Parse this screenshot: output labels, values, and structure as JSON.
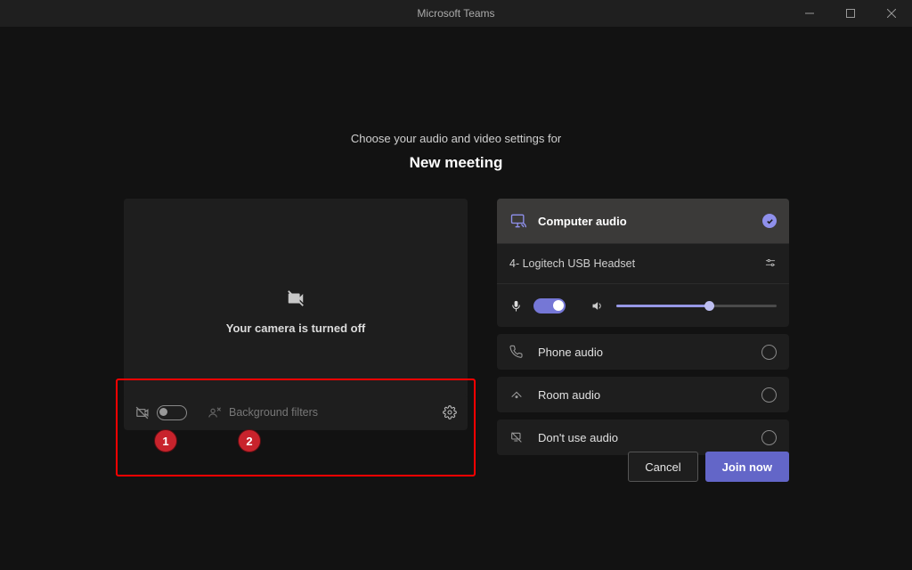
{
  "window": {
    "title": "Microsoft Teams"
  },
  "header": {
    "subtitle": "Choose your audio and video settings for",
    "title": "New meeting"
  },
  "preview": {
    "message": "Your camera is turned off"
  },
  "videoControls": {
    "backgroundFiltersLabel": "Background filters"
  },
  "callouts": {
    "n1": "1",
    "n2": "2"
  },
  "audio": {
    "computerAudio": {
      "label": "Computer audio"
    },
    "device": {
      "name": "4- Logitech USB Headset"
    },
    "phoneAudio": {
      "label": "Phone audio"
    },
    "roomAudio": {
      "label": "Room audio"
    },
    "noAudio": {
      "label": "Don't use audio"
    }
  },
  "actions": {
    "cancel": "Cancel",
    "join": "Join now"
  }
}
